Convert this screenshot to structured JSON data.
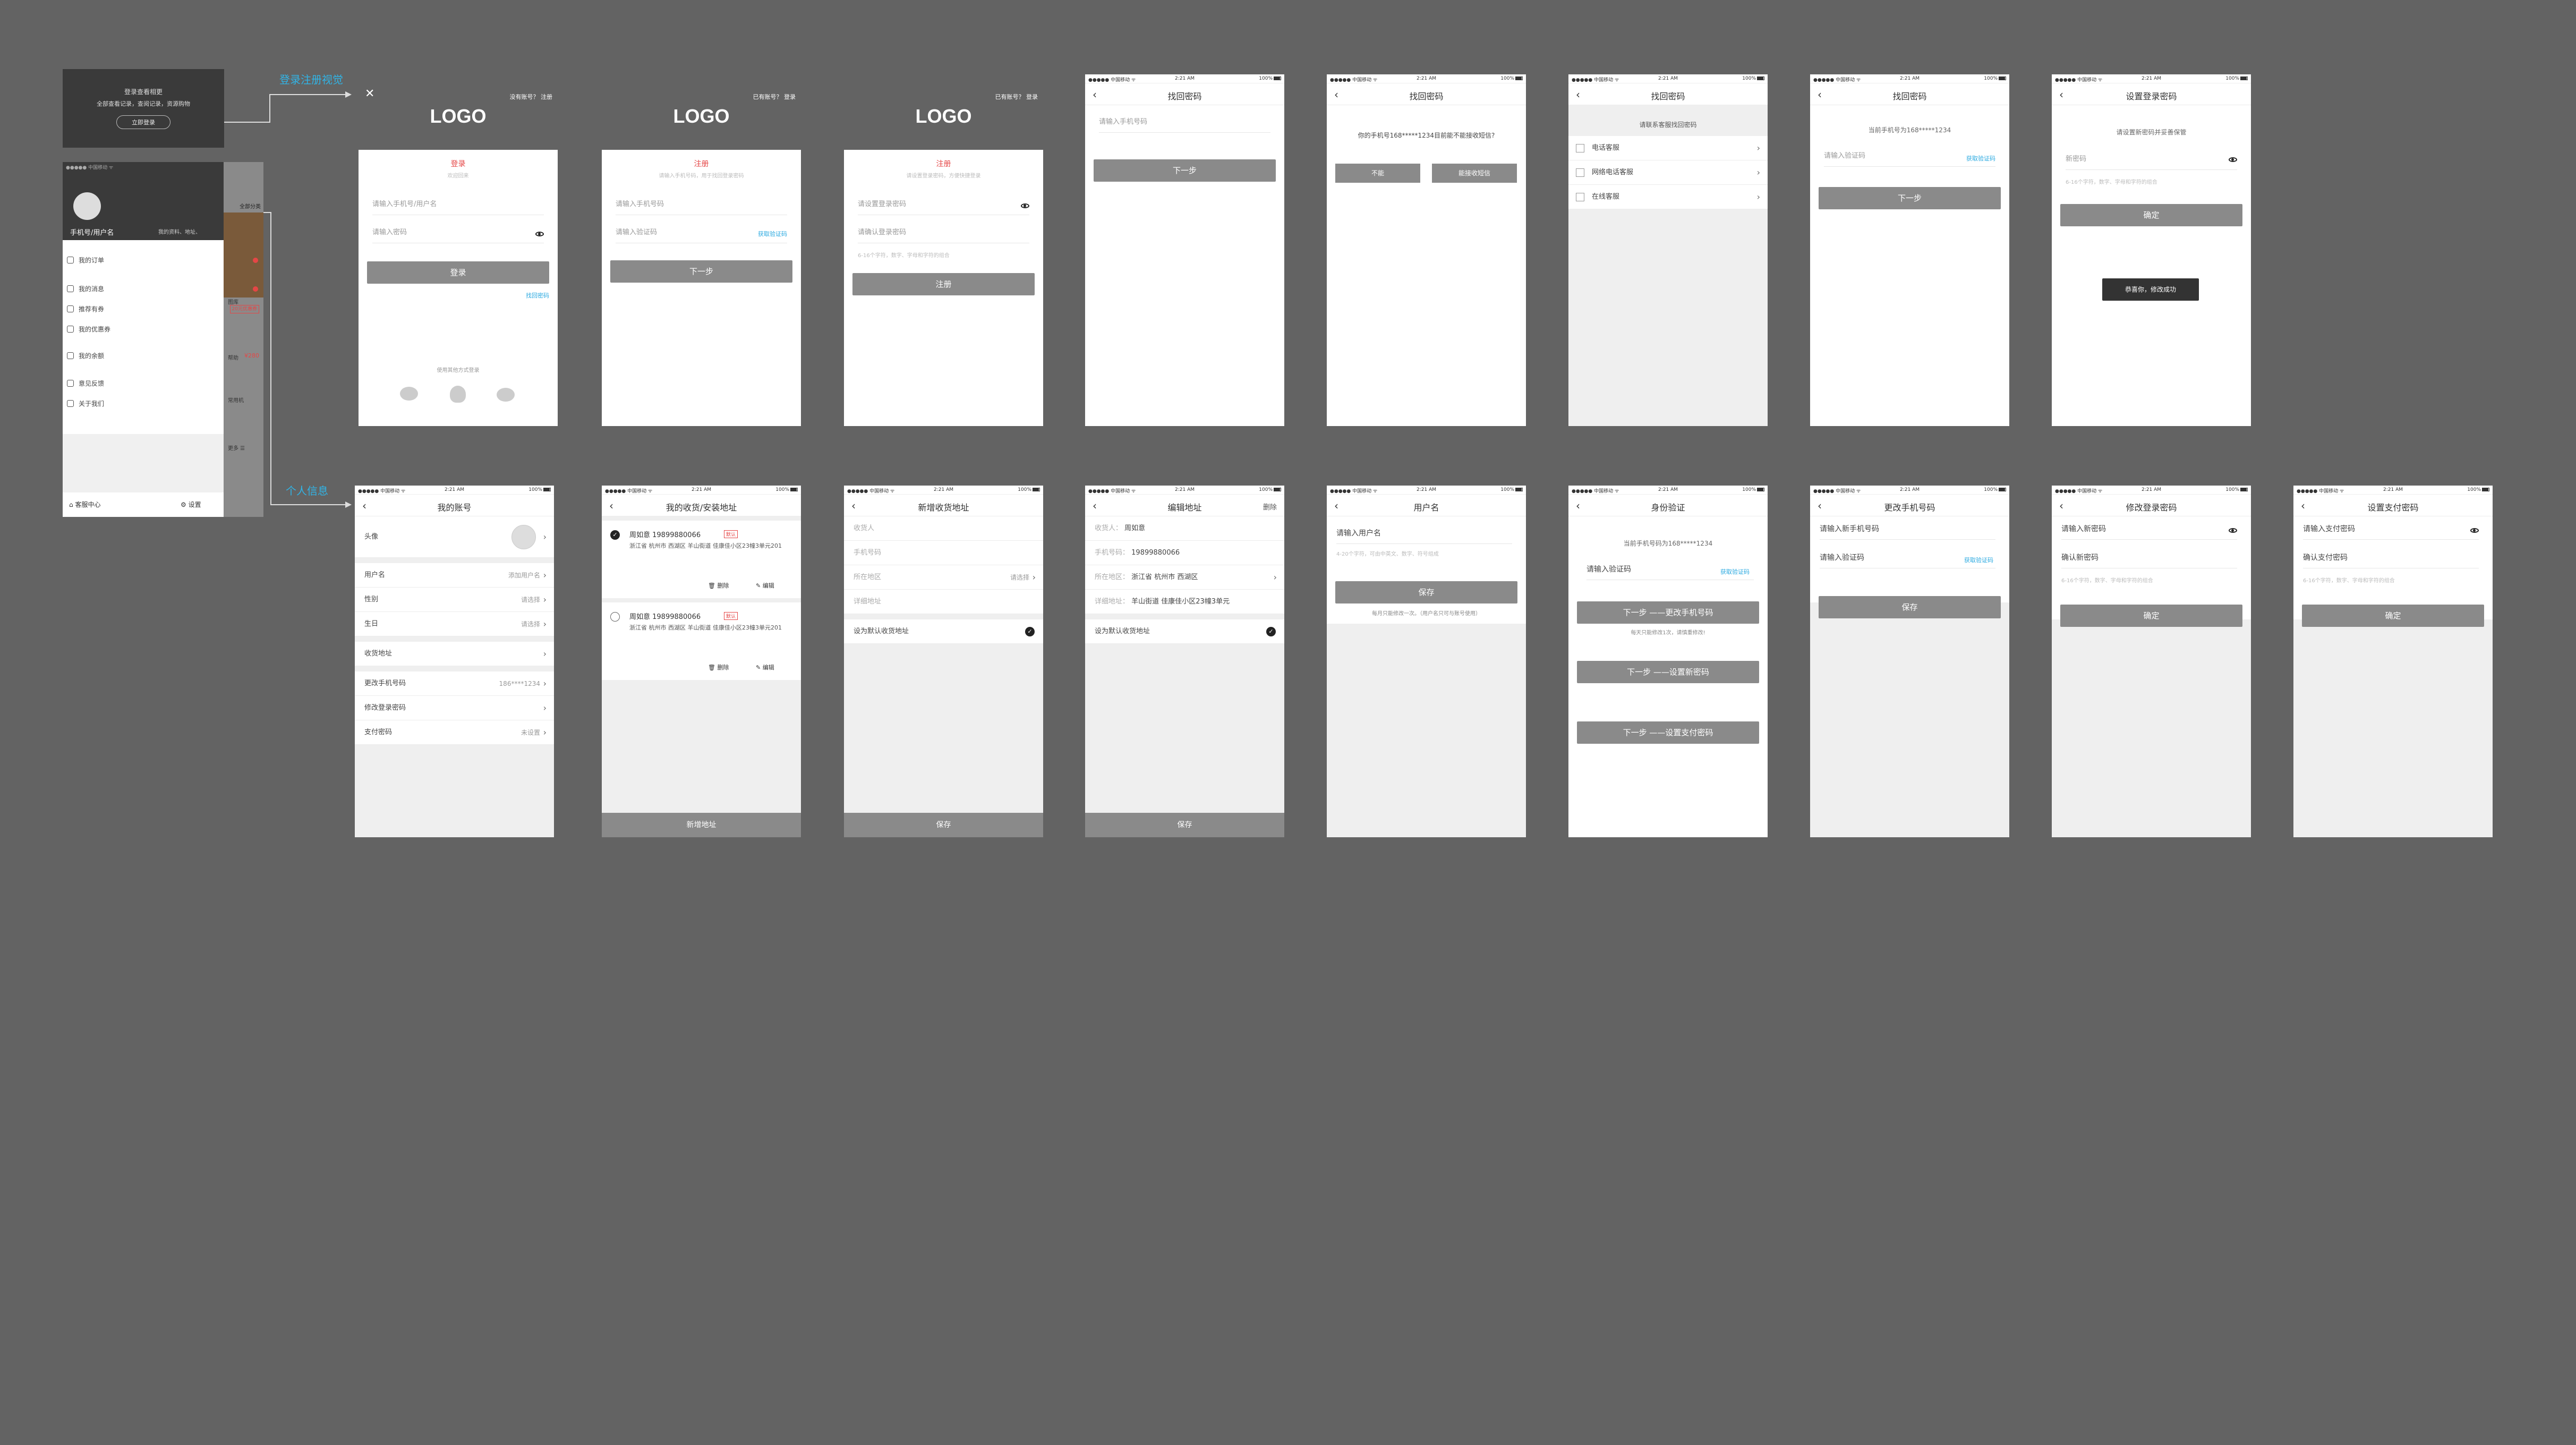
{
  "statusbar": {
    "carrier": "●●●●● 中国移动 ᯤ",
    "time": "2:21 AM",
    "battery": "100%"
  },
  "annotations": {
    "login_flow": "登录注册视觉",
    "profile_flow": "个人信息"
  },
  "guest_prompt": {
    "line1": "登录查看相更",
    "line2": "全部查看记录，查阅记录，资源购物",
    "button": "立即登录"
  },
  "side_menu": {
    "username": "手机号/用户名",
    "profile_link": "我的资料、地址、",
    "items": [
      "我的订单",
      "我的消息",
      "推荐有券",
      "我的优惠券",
      "我的余额",
      "意见反馈",
      "关于我们"
    ],
    "coupon_badge": "20元优惠券",
    "balance": "¥280",
    "bottom_left": "客服中心",
    "bottom_right": "设置",
    "peek_labels": [
      "全部分类",
      "图库",
      "帮助",
      "常用机",
      "更多 ☰"
    ]
  },
  "s_login": {
    "logo": "LOGO",
    "top_right": "没有账号？ 注册",
    "tab": "登录",
    "subtitle": "欢迎回来",
    "account_ph": "请输入手机号/用户名",
    "password_ph": "请输入密码",
    "button": "登录",
    "forgot": "找回密码",
    "social_label": "使用其他方式登录"
  },
  "s_register": {
    "logo": "LOGO",
    "top_right": "已有账号？ 登录",
    "tab": "注册",
    "subtitle": "请输入手机号码，用于找回登录密码",
    "phone_ph": "请输入手机号码",
    "code_ph": "请输入验证码",
    "get_code": "获取验证码",
    "button": "下一步"
  },
  "s_register2": {
    "logo": "LOGO",
    "top_right": "已有账号？ 登录",
    "tab": "注册",
    "subtitle": "请设置登录密码，方便快捷登录",
    "pwd_ph": "请设置登录密码",
    "confirm_ph": "请确认登录密码",
    "hint": "6-16个字符，数字、字母和字符的组合",
    "button": "注册"
  },
  "s_find1": {
    "title": "找回密码",
    "phone_ph": "请输入手机号码",
    "button": "下一步"
  },
  "s_find2": {
    "title": "找回密码",
    "question": "你的手机号168*****1234目前能不能接收短信?",
    "no": "不能",
    "yes": "能接收短信"
  },
  "s_find3": {
    "title": "找回密码",
    "hint": "请联系客服找回密码",
    "items": [
      "电话客服",
      "网络电话客服",
      "在线客服"
    ]
  },
  "s_find4": {
    "title": "找回密码",
    "sent": "当前手机号为168*****1234",
    "code_ph": "请输入验证码",
    "get_code": "获取验证码",
    "button": "下一步"
  },
  "s_setpwd": {
    "title": "设置登录密码",
    "hint": "请设置新密码并妥善保管",
    "pwd_ph": "新密码",
    "pwd_hint": "6-16个字符，数字、字母和字符的组合",
    "button": "确定",
    "toast": "恭喜你，修改成功"
  },
  "s_account": {
    "title": "我的账号",
    "rows": [
      {
        "label": "头像",
        "value": ""
      },
      {
        "label": "用户名",
        "value": "添加用户名"
      },
      {
        "label": "性别",
        "value": "请选择"
      },
      {
        "label": "生日",
        "value": "请选择"
      },
      {
        "label": "收货地址",
        "value": ""
      },
      {
        "label": "更改手机号码",
        "value": "186****1234"
      },
      {
        "label": "修改登录密码",
        "value": ""
      },
      {
        "label": "支付密码",
        "value": "未设置"
      }
    ]
  },
  "s_addresses": {
    "title": "我的收货/安装地址",
    "items": [
      {
        "name": "周如意  19899880066",
        "tag": "默认",
        "addr": "浙江省 杭州市 西湖区 羊山街道 佳康佳小区23幢3单元201",
        "del": "删除",
        "edit": "编辑"
      },
      {
        "name": "周如意  19899880066",
        "tag": "默认",
        "addr": "浙江省 杭州市 西湖区 羊山街道 佳康佳小区23幢3单元201",
        "del": "删除",
        "edit": "编辑"
      }
    ],
    "add": "新增地址"
  },
  "s_newaddr": {
    "title": "新增收货地址",
    "fields": [
      {
        "label": "收货人",
        "value": ""
      },
      {
        "label": "手机号码",
        "value": ""
      },
      {
        "label": "所在地区",
        "value": "请选择"
      },
      {
        "label": "详细地址",
        "value": ""
      }
    ],
    "default": "设为默认收货地址",
    "save": "保存"
  },
  "s_editaddr": {
    "title": "编辑地址",
    "right": "删除",
    "fields": [
      {
        "label": "收货人：",
        "value": "周如意"
      },
      {
        "label": "手机号码：",
        "value": "19899880066"
      },
      {
        "label": "所在地区：",
        "value": "浙江省 杭州市 西湖区"
      },
      {
        "label": "详细地址：",
        "value": "羊山街道 佳康佳小区23幢3单元"
      }
    ],
    "default": "设为默认收货地址",
    "save": "保存"
  },
  "s_username": {
    "title": "用户名",
    "input_ph": "请输入用户名",
    "hint": "4-20个字符，可由中英文、数字、符号组成",
    "button": "保存",
    "note": "每月只能修改一次。（用户名只可与账号使用）"
  },
  "s_verify": {
    "title": "身份验证",
    "sent": "当前手机号码为168*****1234",
    "code_ph": "请输入验证码",
    "get_code": "获取验证码",
    "btn1": "下一步 ——更改手机号码",
    "note1": "每天只能修改1次，请慎重修改!",
    "btn2": "下一步 ——设置新密码",
    "btn3": "下一步 ——设置支付密码"
  },
  "s_changephone": {
    "title": "更改手机号码",
    "phone_ph": "请输入新手机号码",
    "code_ph": "请输入验证码",
    "get_code": "获取验证码",
    "button": "保存"
  },
  "s_changepwd": {
    "title": "修改登录密码",
    "new_ph": "请输入新密码",
    "confirm_ph": "确认新密码",
    "hint": "6-16个字符，数字、字母和字符的组合",
    "button": "确定"
  },
  "s_paypwd": {
    "title": "设置支付密码",
    "pay_ph": "请输入支付密码",
    "confirm_ph": "确认支付密码",
    "hint": "6-16个字符，数字、字母和字符的组合",
    "button": "确定"
  }
}
